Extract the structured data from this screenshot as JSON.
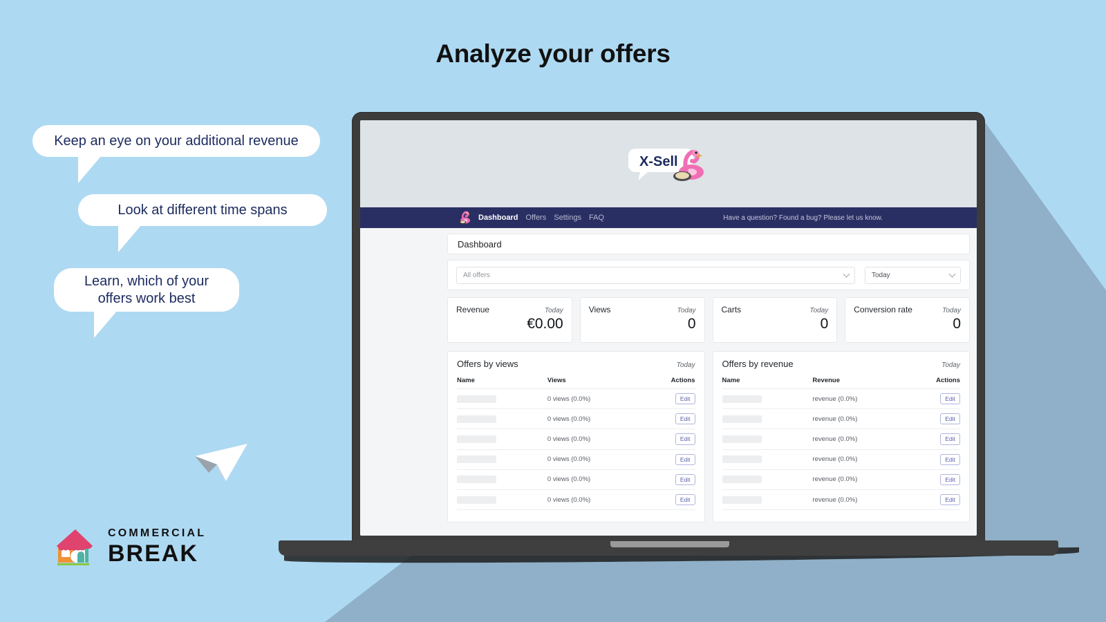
{
  "hero": {
    "title": "Analyze your offers",
    "background_color": "#aed9f2",
    "shadow_color": "#8fb0c8"
  },
  "callouts": [
    {
      "text": "Keep an eye on your additional revenue"
    },
    {
      "text": "Look at different time spans"
    },
    {
      "text_line1": "Learn, which of your",
      "text_line2": "offers work best"
    }
  ],
  "brand_logo": {
    "line1": "COMMERCIAL",
    "line2": "BREAK",
    "mark_colors": {
      "roof": "#e0436d",
      "window": "#f09137",
      "door": "#4fb3a5",
      "base": "#8dc63f"
    }
  },
  "app": {
    "logo_text": "X-Sell",
    "header_bg": "#dde3e6",
    "nav": {
      "bg": "#2a2f63",
      "items": [
        {
          "label": "Dashboard",
          "active": true
        },
        {
          "label": "Offers",
          "active": false
        },
        {
          "label": "Settings",
          "active": false
        },
        {
          "label": "FAQ",
          "active": false
        }
      ],
      "help_text": "Have a question? Found a bug? Please let us know."
    },
    "page_title": "Dashboard",
    "filters": {
      "offer_select_value": "All offers",
      "period_select_value": "Today"
    },
    "stats": [
      {
        "label": "Revenue",
        "period": "Today",
        "value": "€0.00"
      },
      {
        "label": "Views",
        "period": "Today",
        "value": "0"
      },
      {
        "label": "Carts",
        "period": "Today",
        "value": "0"
      },
      {
        "label": "Conversion rate",
        "period": "Today",
        "value": "0"
      }
    ],
    "tables": [
      {
        "title": "Offers by views",
        "period": "Today",
        "columns": [
          "Name",
          "Views",
          "Actions"
        ],
        "action_label": "Edit",
        "rows": [
          {
            "name": "",
            "metric": "0 views (0.0%)"
          },
          {
            "name": "",
            "metric": "0 views (0.0%)"
          },
          {
            "name": "",
            "metric": "0 views (0.0%)"
          },
          {
            "name": "",
            "metric": "0 views (0.0%)"
          },
          {
            "name": "",
            "metric": "0 views (0.0%)"
          },
          {
            "name": "",
            "metric": "0 views (0.0%)"
          }
        ]
      },
      {
        "title": "Offers by revenue",
        "period": "Today",
        "columns": [
          "Name",
          "Revenue",
          "Actions"
        ],
        "action_label": "Edit",
        "rows": [
          {
            "name": "",
            "metric": "revenue (0.0%)"
          },
          {
            "name": "",
            "metric": "revenue (0.0%)"
          },
          {
            "name": "",
            "metric": "revenue (0.0%)"
          },
          {
            "name": "",
            "metric": "revenue (0.0%)"
          },
          {
            "name": "",
            "metric": "revenue (0.0%)"
          },
          {
            "name": "",
            "metric": "revenue (0.0%)"
          }
        ]
      }
    ]
  }
}
